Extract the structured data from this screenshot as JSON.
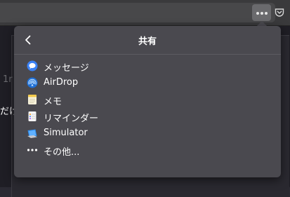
{
  "toolbar": {
    "more_button_label": "•••"
  },
  "background": {
    "text_a": "1r",
    "text_b": "だけ"
  },
  "share_menu": {
    "title": "共有",
    "items": [
      {
        "label": "メッセージ",
        "icon": "messages-icon"
      },
      {
        "label": "AirDrop",
        "icon": "airdrop-icon"
      },
      {
        "label": "メモ",
        "icon": "notes-icon"
      },
      {
        "label": "リマインダー",
        "icon": "reminders-icon"
      },
      {
        "label": "Simulator",
        "icon": "simulator-icon"
      },
      {
        "label": "その他...",
        "icon": "more-icon"
      }
    ]
  },
  "colors": {
    "popup_bg": "#4a494f",
    "toolbar_bg": "#3a3a3c",
    "text": "#ffffff"
  }
}
